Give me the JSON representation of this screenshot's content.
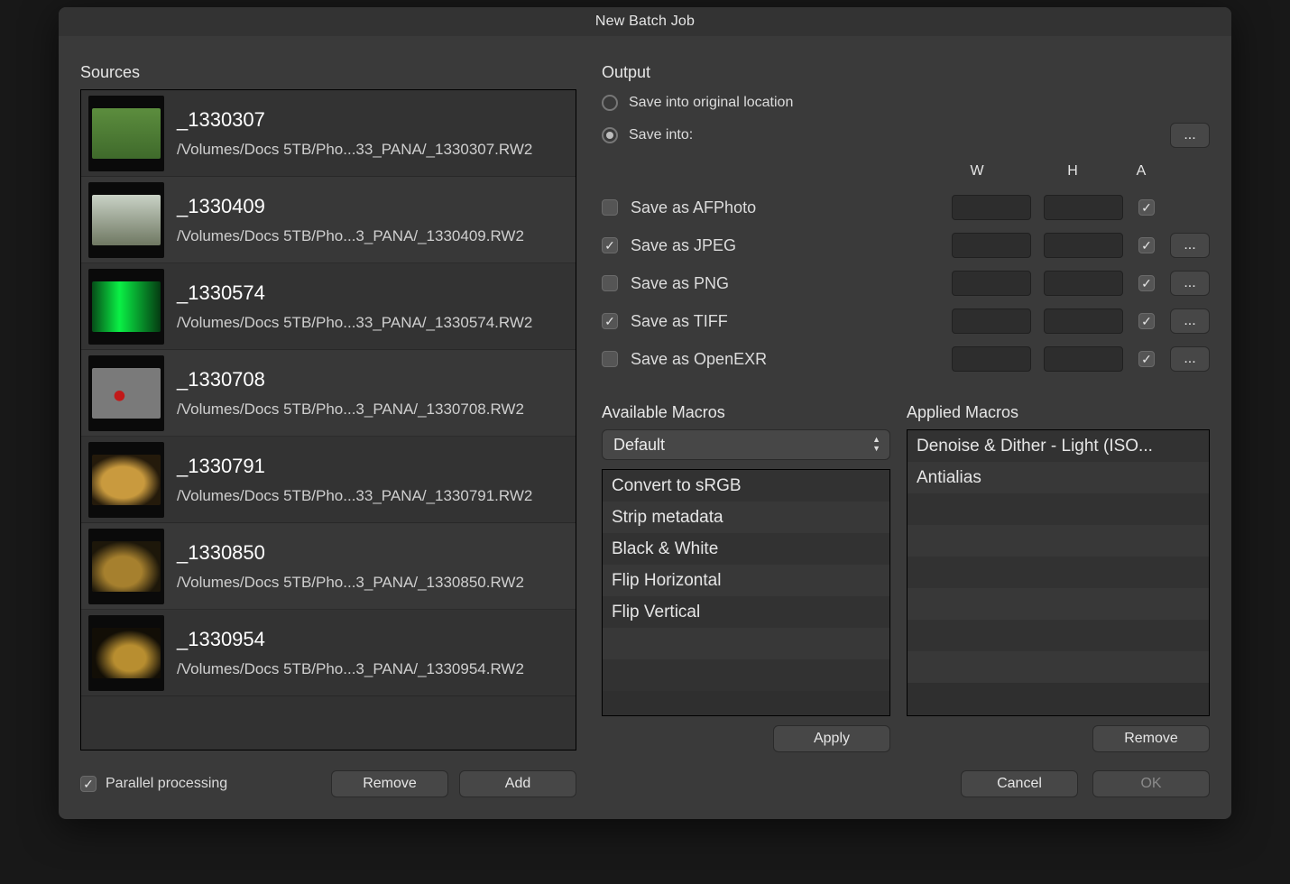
{
  "window": {
    "title": "New Batch Job"
  },
  "sources": {
    "label": "Sources",
    "items": [
      {
        "thumb_class": "th-green",
        "title": "_1330307",
        "path": "/Volumes/Docs 5TB/Pho...33_PANA/_1330307.RW2"
      },
      {
        "thumb_class": "th-tree",
        "title": "_1330409",
        "path": "/Volumes/Docs 5TB/Pho...3_PANA/_1330409.RW2"
      },
      {
        "thumb_class": "th-neon",
        "title": "_1330574",
        "path": "/Volumes/Docs 5TB/Pho...33_PANA/_1330574.RW2"
      },
      {
        "thumb_class": "th-red",
        "title": "_1330708",
        "path": "/Volumes/Docs 5TB/Pho...3_PANA/_1330708.RW2"
      },
      {
        "thumb_class": "th-cave1",
        "title": "_1330791",
        "path": "/Volumes/Docs 5TB/Pho...33_PANA/_1330791.RW2"
      },
      {
        "thumb_class": "th-cave2",
        "title": "_1330850",
        "path": "/Volumes/Docs 5TB/Pho...3_PANA/_1330850.RW2"
      },
      {
        "thumb_class": "th-cave3",
        "title": "_1330954",
        "path": "/Volumes/Docs 5TB/Pho...3_PANA/_1330954.RW2"
      }
    ],
    "parallel_label": "Parallel processing",
    "remove_btn": "Remove",
    "add_btn": "Add"
  },
  "output": {
    "label": "Output",
    "save_original": "Save into original location",
    "save_into": "Save into:",
    "choose_btn": "...",
    "headers": {
      "w": "W",
      "h": "H",
      "a": "A"
    },
    "radio_selected": "save_into",
    "formats": [
      {
        "key": "afphoto",
        "label": "Save as AFPhoto",
        "checked": false,
        "has_more": false
      },
      {
        "key": "jpeg",
        "label": "Save as JPEG",
        "checked": true,
        "has_more": true
      },
      {
        "key": "png",
        "label": "Save as PNG",
        "checked": false,
        "has_more": true
      },
      {
        "key": "tiff",
        "label": "Save as TIFF",
        "checked": true,
        "has_more": true
      },
      {
        "key": "openexr",
        "label": "Save as OpenEXR",
        "checked": false,
        "has_more": true
      }
    ]
  },
  "macros": {
    "available_label": "Available Macros",
    "applied_label": "Applied Macros",
    "popup_value": "Default",
    "available": [
      "Convert to sRGB",
      "Strip metadata",
      "Black & White",
      "Flip Horizontal",
      "Flip Vertical"
    ],
    "applied": [
      "Denoise & Dither - Light (ISO...",
      "Antialias"
    ],
    "apply_btn": "Apply",
    "remove_btn": "Remove"
  },
  "footer": {
    "cancel": "Cancel",
    "ok": "OK"
  }
}
